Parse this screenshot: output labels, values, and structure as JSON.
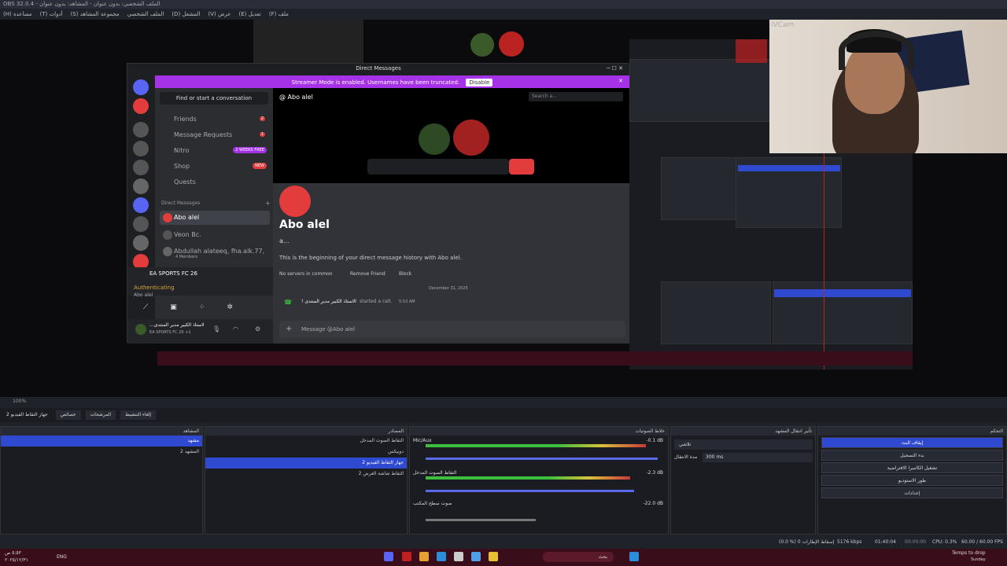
{
  "window_title": "OBS 32.0.4 - الملف الشخصي: بدون عنوان - المشاهد: بدون عنوان",
  "menu": [
    "ملف (F)",
    "تعديل (E)",
    "عرض (V)",
    "المشغل (D)",
    "الملف الشخصي",
    "مجموعة المشاهد (S)",
    "أدوات (T)",
    "مساعدة (H)"
  ],
  "camera_label": "iVCam",
  "discord": {
    "window_title": "Direct Messages",
    "streamer_banner": "Streamer Mode is enabled. Usernames have been truncated.",
    "disable_label": "Disable",
    "find_label": "Find or start a conversation",
    "nav": [
      {
        "label": "Friends",
        "badge": "2"
      },
      {
        "label": "Message Requests",
        "badge": "1"
      },
      {
        "label": "Nitro",
        "pill": "2 WEEKS FREE"
      },
      {
        "label": "Shop",
        "pill": "NEW"
      },
      {
        "label": "Quests"
      }
    ],
    "dm_header": "Direct Messages",
    "dms": [
      {
        "name": "Abo alel"
      },
      {
        "name": "Veon Bc."
      },
      {
        "name": "Abdullah alateeq, fha.alk.77, ...",
        "sub": "4 Members"
      }
    ],
    "activity_game": "EA SPORTS FC 26",
    "activity_status": "Authenticating",
    "activity_user": "Abo alel",
    "user_name": "...الاستاذ الكبير مدير المنتدى",
    "user_status": "EA SPORTS FC 26 +1",
    "chat_name": "Abo alel",
    "search_placeholder": "Search a...",
    "profile_name": "Abo alel",
    "profile_sub": "a...",
    "history_text": "This is the beginning of your direct message history with Abo alel.",
    "no_servers": "No servers in common",
    "remove_friend": "Remove Friend",
    "block": "Block",
    "date": "December 31, 2025",
    "call_msg_user": "! الاستاذ الكبير مدير المنتدى",
    "call_msg_text": "started a call.",
    "call_msg_time": "5:53 AM",
    "message_placeholder": "Message @Abo alel"
  },
  "obs": {
    "zoom": "100%",
    "scene_toolbar": [
      "جهاز التقاط الفيديو 2",
      "خصائص",
      "المرشحات",
      "إلغاء التنشيط"
    ],
    "panels": {
      "scenes": "المشاهد",
      "sources": "المصادر",
      "mixer": "خلاط الصوتيات",
      "transitions": "تأثير انتقال المشهد",
      "controls": "التحكم"
    },
    "scenes": [
      "مشهد",
      "المشهد 2"
    ],
    "sources": [
      "التقاط الصوت المدخل",
      "دوبيكس",
      "جهاز التقاط الفيديو 2",
      "التقاط شاشة العرض 2"
    ],
    "mixer": [
      {
        "name": "Mic/Aux",
        "db": "-0.1 dB"
      },
      {
        "name": "التقاط الصوت المدخل",
        "db": "-2.3 dB"
      },
      {
        "name": "صوت سطح المكتب",
        "db": "-22.0 dB"
      }
    ],
    "meter_ticks": [
      "-60",
      "-55",
      "-50",
      "-45",
      "-40",
      "-35",
      "-30",
      "-25",
      "-20",
      "-15",
      "-10",
      "-5",
      "0"
    ],
    "transition": "تلاشي",
    "duration_label": "مدة الانتقال",
    "duration_value": "300 ms",
    "controls": [
      "إيقاف البث",
      "بدء التسجيل",
      "تشغيل الكاميرا الافتراضية",
      "طور الاستوديو",
      "إعدادات"
    ],
    "status": {
      "dropped": "(0.0 %) 0 إسقاط الإطارات",
      "bitrate": "5176 kbps",
      "stream_time": "01:40:04",
      "rec_time": "00:00:00",
      "cpu": "CPU: 0.3%",
      "fps": "60.00 / 60.00 FPS"
    }
  },
  "taskbar": {
    "time": "٥:٥٣ ص",
    "date": "٢٠٢٥/١٢/٣١",
    "lang": "ENG",
    "search": "بحث",
    "notice_title": "Temps to drop",
    "notice_sub": "Sunday"
  }
}
